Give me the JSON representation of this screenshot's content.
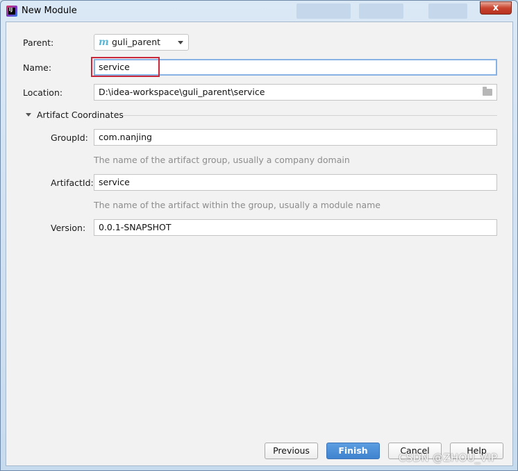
{
  "window": {
    "title": "New Module",
    "close_glyph": "x"
  },
  "form": {
    "parent_label": "Parent:",
    "parent_value": "guli_parent",
    "parent_icon": "m",
    "name_label": "Name:",
    "name_value": "service",
    "location_label": "Location:",
    "location_value": "D:\\idea-workspace\\guli_parent\\service"
  },
  "artifact": {
    "section_title": "Artifact Coordinates",
    "groupid_label": "GroupId:",
    "groupid_value": "com.nanjing",
    "groupid_hint": "The name of the artifact group, usually a company domain",
    "artifactid_label": "ArtifactId:",
    "artifactid_value": "service",
    "artifactid_hint": "The name of the artifact within the group, usually a module name",
    "version_label": "Version:",
    "version_value": "0.0.1-SNAPSHOT"
  },
  "buttons": {
    "previous": "Previous",
    "finish": "Finish",
    "cancel": "Cancel",
    "help": "Help"
  },
  "watermark": "CSDN @ZHOU_VIP",
  "colors": {
    "highlight_box": "#c8283a",
    "primary_button": "#4a8fd8",
    "hint_text": "#8c8c8c"
  }
}
